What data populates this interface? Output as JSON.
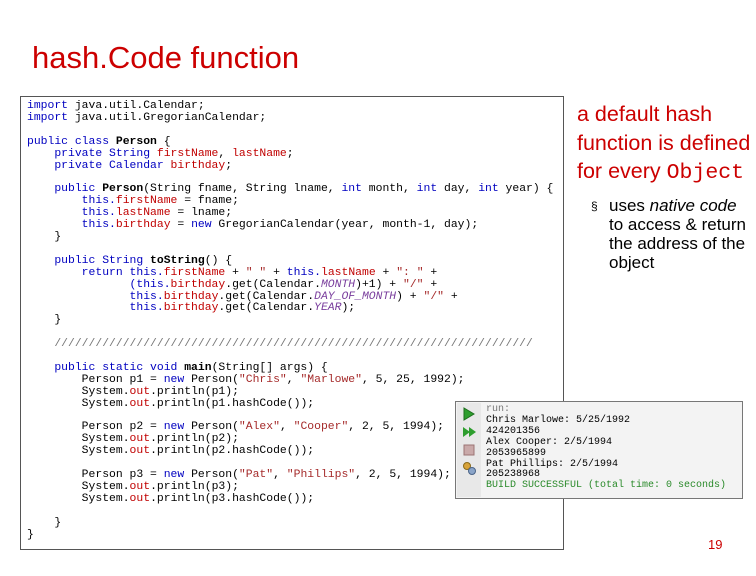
{
  "slide": {
    "title": "hash.Code function",
    "page_number": "19"
  },
  "code": {
    "l01a": "import",
    "l01b": " java.util.Calendar;",
    "l02a": "import",
    "l02b": " java.util.GregorianCalendar;",
    "l04a": "public class",
    "l04b": "Person",
    "l04c": " {",
    "l05a": "    private String ",
    "l05b": "firstName",
    "l05c": ", ",
    "l05d": "lastName",
    "l05e": ";",
    "l06a": "    private Calendar ",
    "l06b": "birthday",
    "l06c": ";",
    "l08a": "    public ",
    "l08b": "Person",
    "l08c": "(String fname, String lname, ",
    "l08d": "int",
    "l08e": " month, ",
    "l08f": "int",
    "l08g": " day, ",
    "l08h": "int",
    "l08i": " year) {",
    "l09a": "        this.",
    "l09b": "firstName",
    "l09c": " = fname;",
    "l10a": "        this.",
    "l10b": "lastName",
    "l10c": " = lname;",
    "l11a": "        this.",
    "l11b": "birthday",
    "l11c": " = ",
    "l11d": "new",
    "l11e": " GregorianCalendar(year, month-1, day);",
    "l12": "    }",
    "l14a": "    public String ",
    "l14b": "toString",
    "l14c": "() {",
    "l15a": "        return this.",
    "l15b": "firstName",
    "l15c": " + ",
    "l15d": "\" \"",
    "l15e": " + ",
    "l15f": "this.",
    "l15g": "lastName",
    "l15h": " + ",
    "l15i": "\": \"",
    "l15j": " +",
    "l16a": "               (this.",
    "l16b": "birthday",
    "l16c": ".get(Calendar.",
    "l16d": "MONTH",
    "l16e": ")+1) + ",
    "l16f": "\"/\"",
    "l16g": " +",
    "l17a": "               this.",
    "l17b": "birthday",
    "l17c": ".get(Calendar.",
    "l17d": "DAY_OF_MONTH",
    "l17e": ") + ",
    "l17f": "\"/\"",
    "l17g": " +",
    "l18a": "               this.",
    "l18b": "birthday",
    "l18c": ".get(Calendar.",
    "l18d": "YEAR",
    "l18e": ");",
    "l19": "    }",
    "l21": "    //////////////////////////////////////////////////////////////////////",
    "l23a": "    public static void ",
    "l23b": "main",
    "l23c": "(String[] args) {",
    "l24a": "        Person p1 = ",
    "l24b": "new",
    "l24c": " Person(",
    "l24d": "\"Chris\"",
    "l24e": ", ",
    "l24f": "\"Marlowe\"",
    "l24g": ", 5, 25, 1992);",
    "l25a": "        System.",
    "l25b": "out",
    "l25c": ".println(p1);",
    "l26a": "        System.",
    "l26b": "out",
    "l26c": ".println(p1.hashCode());",
    "l28a": "        Person p2 = ",
    "l28b": "new",
    "l28c": " Person(",
    "l28d": "\"Alex\"",
    "l28e": ", ",
    "l28f": "\"Cooper\"",
    "l28g": ", 2, 5, 1994);",
    "l29a": "        System.",
    "l29b": "out",
    "l29c": ".println(p2);",
    "l30a": "        System.",
    "l30b": "out",
    "l30c": ".println(p2.hashCode());",
    "l32a": "        Person p3 = ",
    "l32b": "new",
    "l32c": " Person(",
    "l32d": "\"Pat\"",
    "l32e": ", ",
    "l32f": "\"Phillips\"",
    "l32g": ", 2, 5, 1994);",
    "l33a": "        System.",
    "l33b": "out",
    "l33c": ".println(p3);",
    "l34a": "        System.",
    "l34b": "out",
    "l34c": ".println(p3.hashCode());",
    "l36": "    }",
    "l37": "}"
  },
  "bullets": {
    "main_a": "a default hash function is defined for every ",
    "main_b": "Object",
    "sub_marker": "§",
    "sub_a": "uses ",
    "sub_b": "native code",
    "sub_c": " to access & return the address of the object"
  },
  "output": {
    "lines": [
      "run:",
      "Chris Marlowe: 5/25/1992",
      "424201356",
      "Alex Cooper: 2/5/1994",
      "2053965899",
      "Pat Phillips: 2/5/1994",
      "205238968",
      "BUILD SUCCESSFUL (total time: 0 seconds)"
    ],
    "toolbar_icons": [
      "run-icon",
      "rerun-icon",
      "stop-icon",
      "settings-icon"
    ]
  },
  "colors": {
    "accent": "#cc0000",
    "keyword": "#0000c0",
    "field": "#c00000",
    "string": "#a52a2a",
    "constant": "#7a3e9d",
    "success": "#2a8a2a"
  }
}
